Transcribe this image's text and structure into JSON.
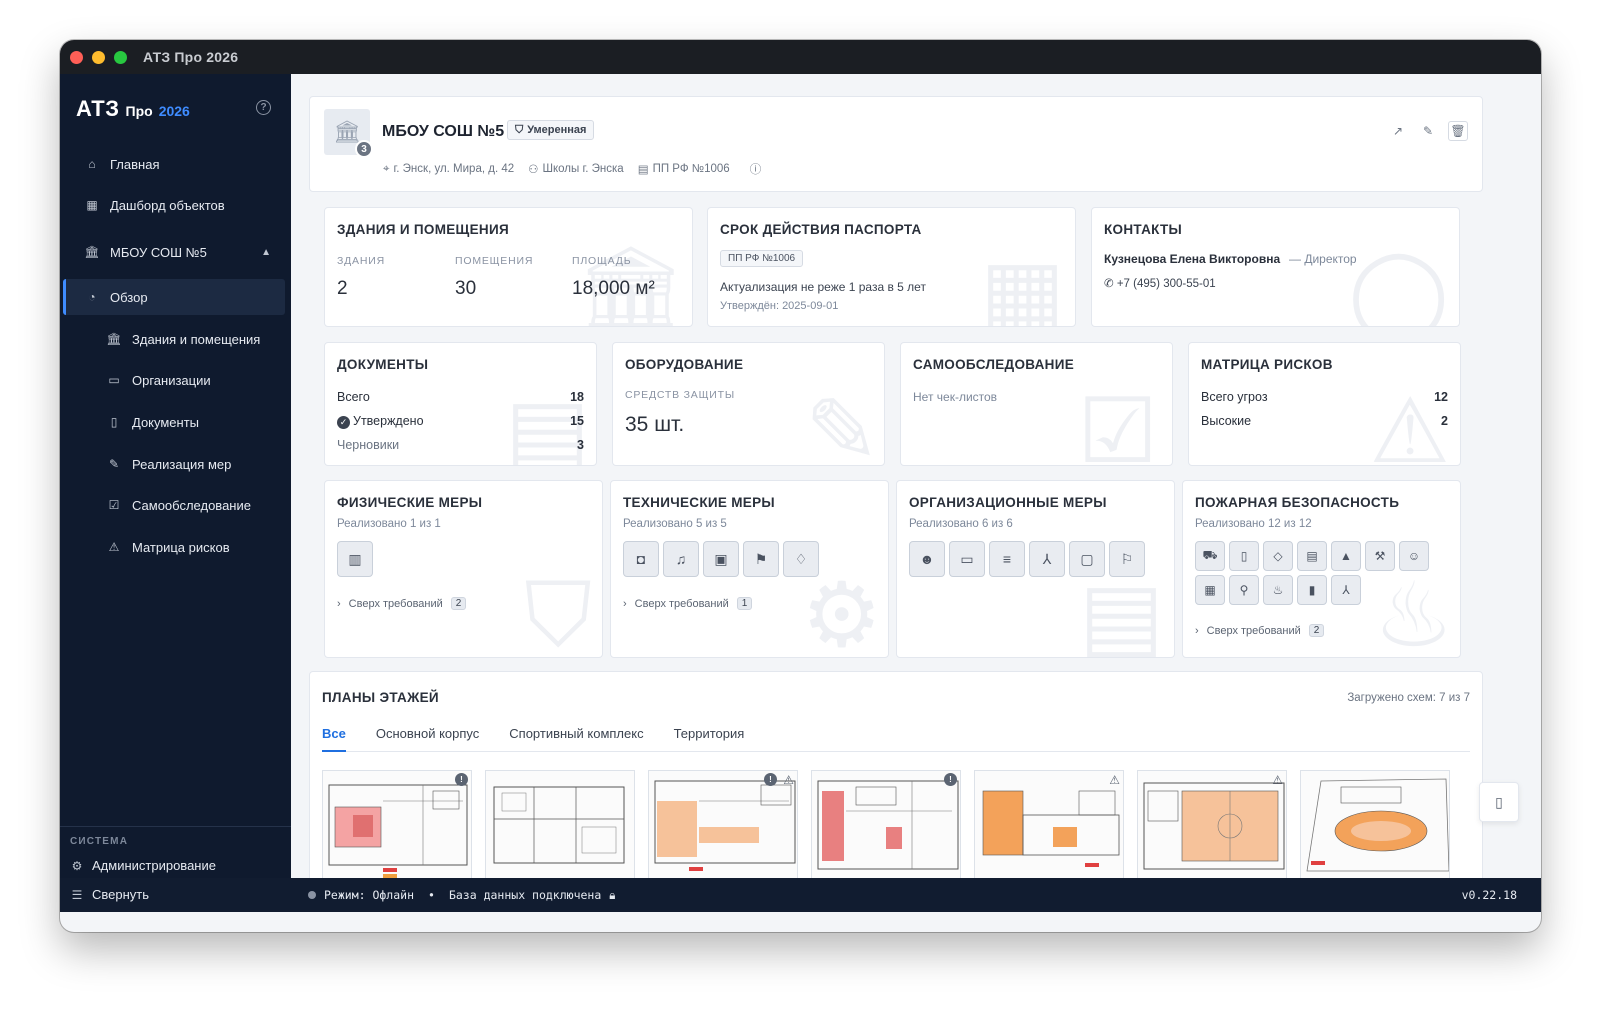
{
  "window": {
    "title": "АТЗ Про 2026"
  },
  "brand": {
    "name": "АТЗ",
    "product": "Про",
    "year": "2026"
  },
  "sidebar": {
    "items": [
      {
        "label": "Главная",
        "icon": "home-icon"
      },
      {
        "label": "Дашборд объектов",
        "icon": "grid-icon"
      },
      {
        "label": "МБОУ СОШ №5",
        "icon": "building-icon"
      },
      {
        "label": "Обзор",
        "icon": "gauge-icon"
      },
      {
        "label": "Здания и помещения",
        "icon": "building-icon"
      },
      {
        "label": "Организации",
        "icon": "id-card-icon"
      },
      {
        "label": "Документы",
        "icon": "document-icon"
      },
      {
        "label": "Реализация мер",
        "icon": "wrench-icon"
      },
      {
        "label": "Самообследование",
        "icon": "checklist-icon"
      },
      {
        "label": "Матрица рисков",
        "icon": "warning-icon"
      }
    ],
    "system_label": "СИСТЕМА",
    "admin_label": "Администрирование",
    "collapse_label": "Свернуть"
  },
  "object": {
    "name": "МБОУ СОШ №5",
    "badge_count": "3",
    "risk_tag": "Умеренная",
    "address": "г. Энск, ул. Мира, д. 42",
    "group": "Школы г. Энска",
    "regulation": "ПП РФ №1006"
  },
  "buildings_card": {
    "title": "ЗДАНИЯ И ПОМЕЩЕНИЯ",
    "buildings_label": "ЗДАНИЯ",
    "buildings_value": "2",
    "rooms_label": "ПОМЕЩЕНИЯ",
    "rooms_value": "30",
    "area_label": "ПЛОЩАДЬ",
    "area_value": "18,000 м²"
  },
  "passport_card": {
    "title": "СРОК ДЕЙСТВИЯ ПАСПОРТА",
    "chip": "ПП РФ №1006",
    "text": "Актуализация не реже 1 раза в 5 лет",
    "approved": "Утверждён: 2025-09-01"
  },
  "contacts_card": {
    "title": "КОНТАКТЫ",
    "name": "Кузнецова Елена Викторовна",
    "role": "— Директор",
    "phone": "+7 (495) 300-55-01"
  },
  "documents_card": {
    "title": "ДОКУМЕНТЫ",
    "total_label": "Всего",
    "total_value": "18",
    "approved_label": "Утверждено",
    "approved_value": "15",
    "drafts_label": "Черновики",
    "drafts_value": "3"
  },
  "equipment_card": {
    "title": "ОБОРУДОВАНИЕ",
    "label": "СРЕДСТВ ЗАЩИТЫ",
    "value": "35 шт."
  },
  "selfcheck_card": {
    "title": "САМООБСЛЕДОВАНИЕ",
    "text": "Нет чек-листов"
  },
  "risk_card": {
    "title": "МАТРИЦА РИСКОВ",
    "total_label": "Всего угроз",
    "total_value": "12",
    "high_label": "Высокие",
    "high_value": "2"
  },
  "measures": {
    "physical": {
      "title": "ФИЗИЧЕСКИЕ МЕРЫ",
      "status": "Реализовано 1 из 1",
      "extra_label": "Сверх требований",
      "extra_count": "2"
    },
    "technical": {
      "title": "ТЕХНИЧЕСКИЕ МЕРЫ",
      "status": "Реализовано 5 из 5",
      "extra_label": "Сверх требований",
      "extra_count": "1"
    },
    "organizational": {
      "title": "ОРГАНИЗАЦИОННЫЕ МЕРЫ",
      "status": "Реализовано 6 из 6"
    },
    "fire": {
      "title": "ПОЖАРНАЯ БЕЗОПАСНОСТЬ",
      "status": "Реализовано 12 из 12",
      "extra_label": "Сверх требований",
      "extra_count": "2"
    }
  },
  "plans": {
    "title": "ПЛАНЫ ЭТАЖЕЙ",
    "loaded": "Загружено схем: 7 из 7",
    "tabs": [
      "Все",
      "Основной корпус",
      "Спортивный комплекс",
      "Территория"
    ],
    "active_tab": "Все"
  },
  "status": {
    "mode": "Режим: Офлайн",
    "db": "База данных подключена",
    "version": "v0.22.18"
  },
  "colors": {
    "accent": "#3f8cff",
    "sidebar_bg": "#0f1a2e",
    "active_tab": "#1f6fe0"
  }
}
